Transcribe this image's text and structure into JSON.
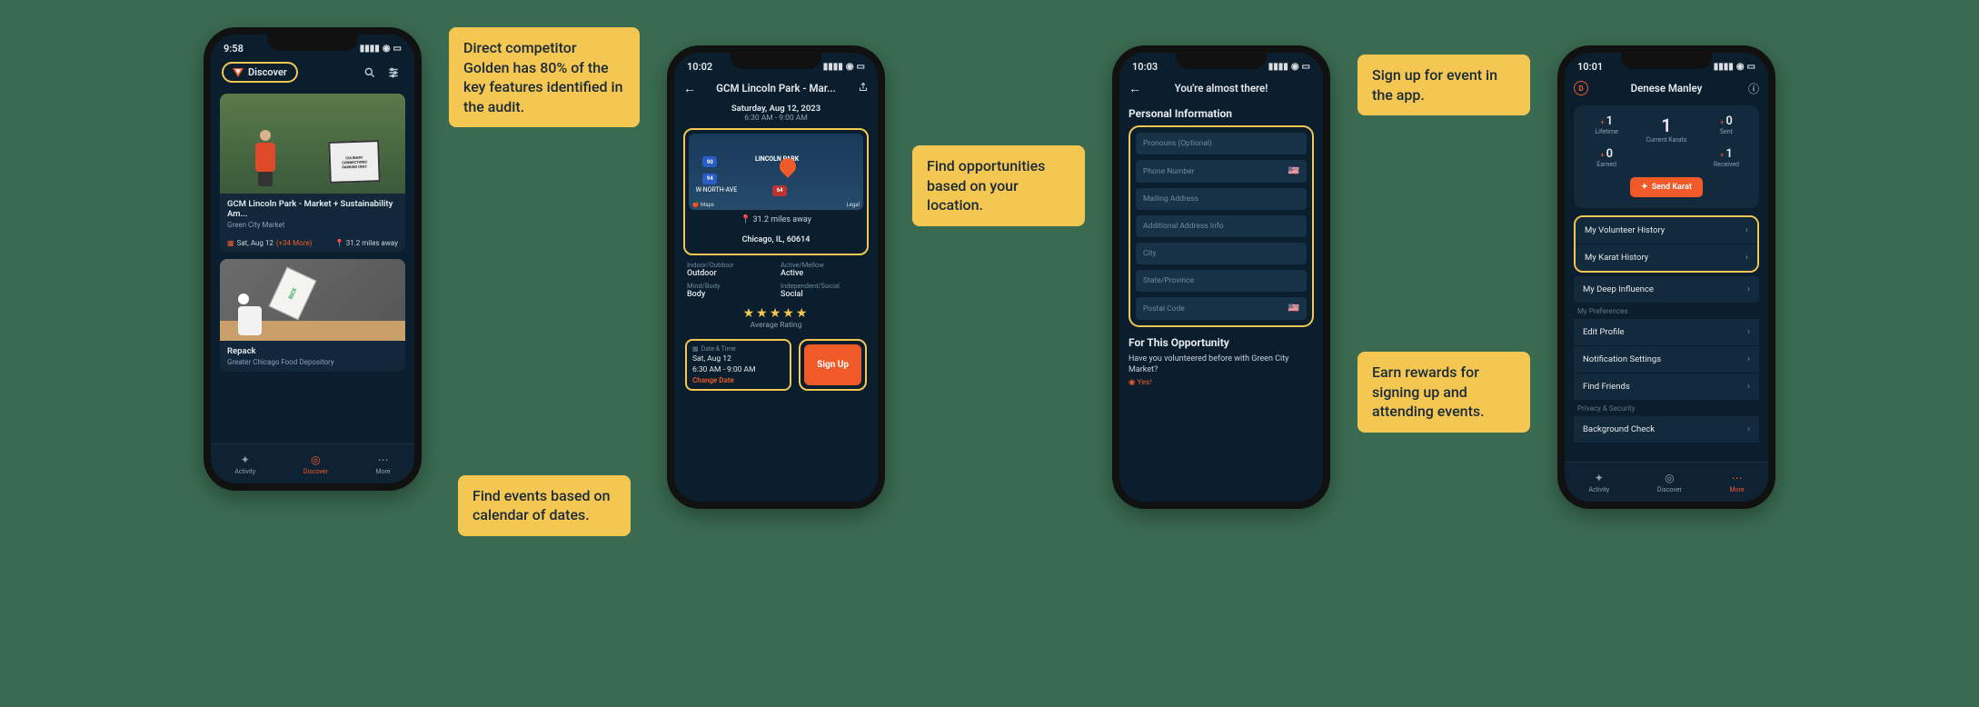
{
  "callouts": {
    "competitor": "Direct competitor Golden has 80% of the key features identified in the audit.",
    "location": "Find opportunities based on your location.",
    "calendar": "Find events based on calendar of dates.",
    "signup": "Sign up for event in the app.",
    "rewards": "Earn rewards for signing up and attending events."
  },
  "phone1": {
    "time": "9:58",
    "brand_label": "Discover",
    "card1": {
      "title": "GCM Lincoln Park - Market + Sustainability Am...",
      "org": "Green City Market",
      "date": "Sat, Aug 12",
      "more": "(+34 More)",
      "distance": "31.2 miles away",
      "sign_l1": "CULINARY",
      "sign_l2": "CONNECTIONS",
      "sign_l3": "PARKING ONLY"
    },
    "card2": {
      "title": "Repack",
      "org": "Greater Chicago Food Depository"
    },
    "tabs": {
      "activity": "Activity",
      "discover": "Discover",
      "more": "More"
    }
  },
  "phone2": {
    "time": "10:02",
    "title": "GCM Lincoln Park - Mar...",
    "date": "Saturday, Aug 12, 2023",
    "time_range": "6:30 AM - 9:00 AM",
    "map": {
      "area_label": "LINCOLN PARK",
      "street": "W-NORTH-AVE",
      "hwy1": "90",
      "hwy2": "94",
      "hwy3": "64",
      "provider": "Maps",
      "legal": "Legal"
    },
    "distance": "31.2 miles away",
    "city_line": "Chicago, IL, 60614",
    "attrs": {
      "io_lbl": "Indoor/Outdoor",
      "io_val": "Outdoor",
      "am_lbl": "Active/Mellow",
      "am_val": "Active",
      "mb_lbl": "Mind/Body",
      "mb_val": "Body",
      "is_lbl": "Independent/Social",
      "is_val": "Social"
    },
    "rating_label": "Average Rating",
    "dt": {
      "label": "Date & Time",
      "line1": "Sat, Aug 12",
      "line2": "6:30 AM - 9:00 AM",
      "change": "Change Date"
    },
    "signup": "Sign Up"
  },
  "phone3": {
    "time": "10:03",
    "title": "You're almost there!",
    "section": "Personal Information",
    "fields": {
      "pronouns": "Pronouns (Optional)",
      "phone": "Phone Number",
      "mailing": "Mailing Address",
      "addr2": "Additional Address Info",
      "city": "City",
      "state": "State/Province",
      "postal": "Postal Code"
    },
    "section2": "For This Opportunity",
    "question": "Have you volunteered before with Green City Market?",
    "answer": "Yes!"
  },
  "phone4": {
    "time": "10:01",
    "name": "Denese Manley",
    "initial": "D",
    "stats": {
      "lifetime_n": "1",
      "lifetime_l": "Lifetime",
      "current_n": "1",
      "current_l": "Current Karats",
      "sent_n": "0",
      "sent_l": "Sent",
      "earned_n": "0",
      "earned_l": "Earned",
      "received_n": "1",
      "received_l": "Received"
    },
    "send_karat": "Send Karat",
    "menu": {
      "vol_history": "My Volunteer History",
      "karat_history": "My Karat History",
      "deep_influence": "My Deep Influence",
      "prefs_header": "My Preferences",
      "edit_profile": "Edit Profile",
      "notif": "Notification Settings",
      "friends": "Find Friends",
      "privacy_header": "Privacy & Security",
      "bg_check": "Background Check"
    },
    "tabs": {
      "activity": "Activity",
      "discover": "Discover",
      "more": "More"
    }
  }
}
